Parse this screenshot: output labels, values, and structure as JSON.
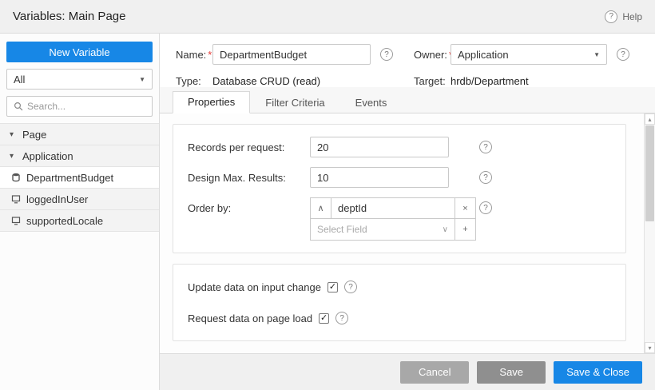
{
  "header": {
    "title": "Variables: Main Page",
    "help_label": "Help"
  },
  "sidebar": {
    "new_variable_button": "New Variable",
    "filter_value": "All",
    "search_placeholder": "Search...",
    "groups": [
      {
        "label": "Page"
      },
      {
        "label": "Application"
      }
    ],
    "variables": [
      {
        "label": "DepartmentBudget",
        "selected": true
      },
      {
        "label": "loggedInUser",
        "selected": false
      },
      {
        "label": "supportedLocale",
        "selected": false
      }
    ]
  },
  "form": {
    "name_label": "Name:",
    "name_value": "DepartmentBudget",
    "owner_label": "Owner:",
    "owner_value": "Application",
    "type_label": "Type:",
    "type_value": "Database CRUD (read)",
    "target_label": "Target:",
    "target_value": "hrdb/Department"
  },
  "tabs": [
    {
      "label": "Properties",
      "active": true
    },
    {
      "label": "Filter Criteria",
      "active": false
    },
    {
      "label": "Events",
      "active": false
    }
  ],
  "properties": {
    "records_label": "Records per request:",
    "records_value": "20",
    "design_max_label": "Design Max. Results:",
    "design_max_value": "10",
    "order_by_label": "Order by:",
    "order_by_value": "deptId",
    "select_field_placeholder": "Select Field",
    "update_on_change_label": "Update data on input change",
    "update_on_change_checked": true,
    "request_on_load_label": "Request data on page load",
    "request_on_load_checked": true
  },
  "footer": {
    "cancel": "Cancel",
    "save": "Save",
    "save_close": "Save & Close"
  },
  "icons": {
    "help": "?",
    "required": "*",
    "select_caret": "▼",
    "tree_caret": "▾",
    "chevron_up": "∧",
    "chevron_down": "∨",
    "close": "×",
    "plus": "+",
    "check": "✓",
    "scroll_up": "▴",
    "scroll_down": "▾"
  },
  "colors": {
    "accent": "#1787e6",
    "required": "#e53935",
    "cancel_button": "#a8a8a8",
    "save_button": "#8f8f8f"
  }
}
